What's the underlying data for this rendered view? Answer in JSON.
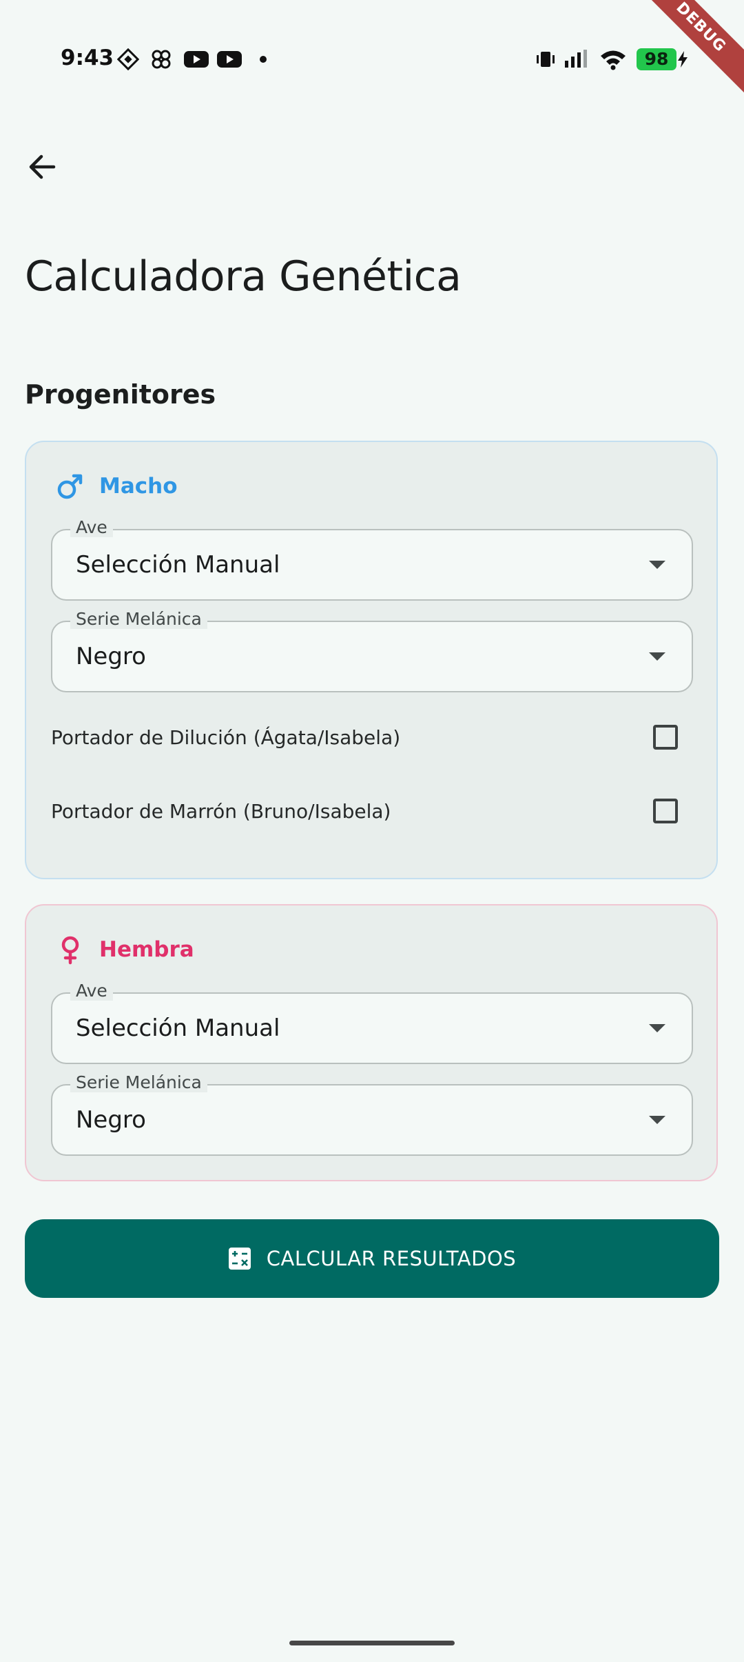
{
  "status_bar": {
    "time": "9:43",
    "left_icons": [
      "diamond-app-icon",
      "pinwheel-app-icon",
      "youtube-icon",
      "youtube-icon",
      "dot-icon"
    ],
    "right_icons": [
      "vibrate-icon",
      "signal-icon",
      "wifi-icon",
      "battery-icon"
    ],
    "battery": "98",
    "debug_banner": "DEBUG"
  },
  "app_bar": {
    "back_icon": "arrow-back-icon",
    "title": "Calculadora Genética"
  },
  "section": {
    "title": "Progenitores"
  },
  "male": {
    "label": "Macho",
    "icon": "male-icon",
    "color": "#2f96e4",
    "bird_field": {
      "label": "Ave",
      "value": "Selección Manual"
    },
    "melanic_field": {
      "label": "Serie Melánica",
      "value": "Negro"
    },
    "checkboxes": [
      {
        "label": "Portador de Dilución (Ágata/Isabela)",
        "checked": false
      },
      {
        "label": "Portador de Marrón (Bruno/Isabela)",
        "checked": false
      }
    ]
  },
  "female": {
    "label": "Hembra",
    "icon": "female-icon",
    "color": "#e0306a",
    "bird_field": {
      "label": "Ave",
      "value": "Selección Manual"
    },
    "melanic_field": {
      "label": "Serie Melánica",
      "value": "Negro"
    }
  },
  "calculate_button": {
    "label": "CALCULAR RESULTADOS",
    "icon": "calculate-icon",
    "color": "#006a62"
  },
  "colors": {
    "background": "#f3f8f6",
    "card": "#e8eeec"
  }
}
